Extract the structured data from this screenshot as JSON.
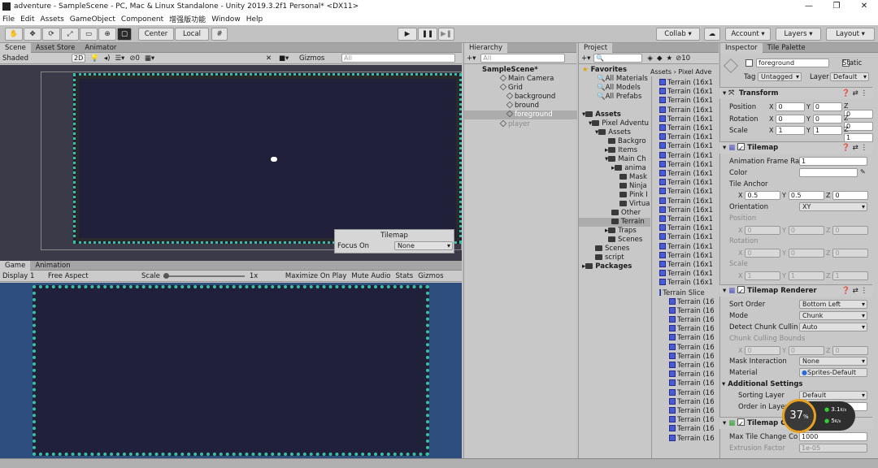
{
  "window": {
    "title": "adventure - SampleScene - PC, Mac & Linux Standalone - Unity 2019.3.2f1 Personal* <DX11>",
    "min": "—",
    "max": "❐",
    "close": "✕"
  },
  "menu": [
    "File",
    "Edit",
    "Assets",
    "GameObject",
    "Component",
    "增强版功能",
    "Window",
    "Help"
  ],
  "toolbar": {
    "center": "Center",
    "local": "Local",
    "collab": "Collab ▾",
    "account": "Account ▾",
    "layers": "Layers ▾",
    "layout": "Layout ▾",
    "play": "▶",
    "pause": "❚❚",
    "step": "▶❚"
  },
  "scene": {
    "tabs": [
      "Scene",
      "Asset Store",
      "Animator"
    ],
    "shading": "Shaded",
    "mode2d": "2D",
    "fx_count": "0",
    "gizmos": "Gizmos",
    "search_placeholder": "All",
    "tilemap_overlay": {
      "title": "Tilemap",
      "focus_label": "Focus On",
      "focus_value": "None"
    }
  },
  "game": {
    "tabs": [
      "Game",
      "Animation"
    ],
    "display": "Display 1",
    "aspect": "Free Aspect",
    "scale_label": "Scale",
    "scale_value": "1x",
    "maximize": "Maximize On Play",
    "mute": "Mute Audio",
    "stats": "Stats",
    "gizmos": "Gizmos"
  },
  "hierarchy": {
    "tab": "Hierarchy",
    "search_placeholder": "All",
    "items": [
      {
        "label": "SampleScene*"
      },
      {
        "label": "Main Camera"
      },
      {
        "label": "Grid"
      },
      {
        "label": "background"
      },
      {
        "label": "bround"
      },
      {
        "label": "foreground"
      },
      {
        "label": "player"
      }
    ]
  },
  "project": {
    "tab": "Project",
    "breadcrumb": "Assets › Pixel Adve",
    "badge_count": "10",
    "favorites": "Favorites",
    "fav_items": [
      "All Materials",
      "All Models",
      "All Prefabs"
    ],
    "tree": [
      {
        "label": "Assets"
      },
      {
        "label": "Pixel Adventu"
      },
      {
        "label": "Assets"
      },
      {
        "label": "Backgro"
      },
      {
        "label": "Items"
      },
      {
        "label": "Main Ch"
      },
      {
        "label": "anima"
      },
      {
        "label": "Mask"
      },
      {
        "label": "Ninja"
      },
      {
        "label": "Pink I"
      },
      {
        "label": "Virtua"
      },
      {
        "label": "Other"
      },
      {
        "label": "Terrain"
      },
      {
        "label": "Traps"
      },
      {
        "label": "Scenes"
      },
      {
        "label": "Scenes"
      },
      {
        "label": "script"
      },
      {
        "label": "Packages"
      }
    ],
    "terrain_label": "Terrain (16x1",
    "slice_label": "Terrain Slice",
    "slice_item": "Terrain (16"
  },
  "inspector": {
    "tabs": [
      "Inspector",
      "Tile Palette"
    ],
    "name": "foreground",
    "static": "Static",
    "tag_label": "Tag",
    "tag": "Untagged",
    "layer_label": "Layer",
    "layer": "Default",
    "transform": {
      "title": "Transform",
      "position": [
        "0",
        "0",
        "0"
      ],
      "rotation": [
        "0",
        "0",
        "0"
      ],
      "scale": [
        "1",
        "1",
        "1"
      ],
      "labels": [
        "Position",
        "Rotation",
        "Scale"
      ]
    },
    "tilemap": {
      "title": "Tilemap",
      "anim_label": "Animation Frame Rat",
      "anim_value": "1",
      "color_label": "Color",
      "anchor_label": "Tile Anchor",
      "anchor": [
        "0.5",
        "0.5",
        "0"
      ],
      "orientation_label": "Orientation",
      "orientation": "XY",
      "position_label": "Position",
      "rotation_label": "Rotation",
      "scale_label": "Scale",
      "gpos": [
        "0",
        "0",
        "0"
      ],
      "grot": [
        "0",
        "0",
        "0"
      ],
      "gscale": [
        "1",
        "1",
        "1"
      ]
    },
    "renderer": {
      "title": "Tilemap Renderer",
      "sort_label": "Sort Order",
      "sort": "Bottom Left",
      "mode_label": "Mode",
      "mode": "Chunk",
      "detect_label": "Detect Chunk Culling",
      "detect": "Auto",
      "bounds_label": "Chunk Culling Bounds",
      "bounds": [
        "0",
        "0",
        "0"
      ],
      "mask_label": "Mask Interaction",
      "mask": "None",
      "material_label": "Material",
      "material": "Sprites-Default",
      "additional": "Additional Settings",
      "sorting_layer_label": "Sorting Layer",
      "sorting_layer": "Default",
      "order_label": "Order in Layer"
    },
    "collider": {
      "title": "Tilemap Collider",
      "max_label": "Max Tile Change Co",
      "max": "1000",
      "extrusion_label": "Extrusion Factor",
      "extrusion": "1e-05"
    }
  },
  "overlay_meter": {
    "percent": "37",
    "percent_unit": "%",
    "up": "3.1",
    "up_unit": "K/s",
    "down": "5",
    "down_unit": "K/s"
  },
  "axis": {
    "x": "X",
    "y": "Y",
    "z": "Z"
  }
}
